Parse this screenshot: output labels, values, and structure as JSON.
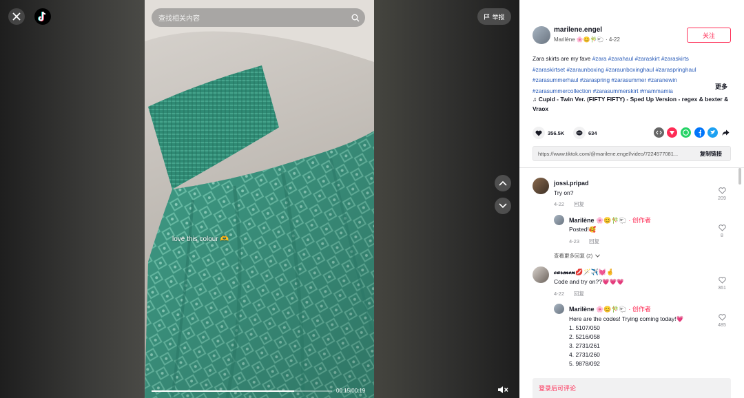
{
  "video": {
    "search_placeholder": "查找相关内容",
    "report_label": "举报",
    "caption": "love this colour 🫶",
    "progress": 0.79,
    "time": "00:15/00:19"
  },
  "author": {
    "username": "marilene.engel",
    "display_name": "Marilène 🌸😊🎋🐑",
    "date": "4-22",
    "follow_label": "关注"
  },
  "description": {
    "text": "Zara skirts are my fave",
    "tags": [
      "#zara",
      "#zarahaul",
      "#zaraskirt",
      "#zaraskirts",
      "#zaraskirtset",
      "#zaraunboxing",
      "#zaraunboxinghaul",
      "#zaraspringhaul",
      "#zarasummerhaul",
      "#zaraspring",
      "#zarasummer",
      "#zaranewin",
      "#zarasummercollection",
      "#zarasummerskirt",
      "#mammamia"
    ],
    "more_label": "更多"
  },
  "music": "♫  Cupid - Twin Ver. (FIFTY FIFTY) - Sped Up Version - regex & bexter & Vraox",
  "stats": {
    "likes": "356.5K",
    "comments": "634"
  },
  "link": {
    "url": "https://www.tiktok.com/@marilene.engel/video/7224577081...",
    "copy_label": "复制链接"
  },
  "comments": [
    {
      "user": "jossi.pripad",
      "text": "Try on?",
      "date": "4-22",
      "reply_label": "回复",
      "likes": "209"
    },
    {
      "user": "Marilène 🌸😊🎋🐑",
      "creator_tag": "· 创作者",
      "text": "Posted!🥰",
      "date": "4-23",
      "reply_label": "回复",
      "likes": "8"
    },
    {
      "view_more": "查看更多回复 (2)"
    },
    {
      "user": "𝓬𝓪𝓻𝓶𝓮𝓷💋🪄✈️💓🤞",
      "text": "Code and try on??💗💗💗",
      "date": "4-22",
      "reply_label": "回复",
      "likes": "361"
    },
    {
      "user": "Marilène 🌸😊🎋🐑",
      "creator_tag": "· 创作者",
      "text": "Here are the codes! Trying coming today!💗",
      "lines": [
        "1. 5107/050",
        "2. 5216/058",
        "3. 2731/261",
        "4. 2731/260",
        "5. 9878/092"
      ],
      "likes": "485"
    }
  ],
  "bottom": {
    "login_prompt": "登录后可评论"
  },
  "colors": {
    "accent": "#fe2c55",
    "tag": "#2b5db9",
    "dress": "#3f9c86"
  }
}
